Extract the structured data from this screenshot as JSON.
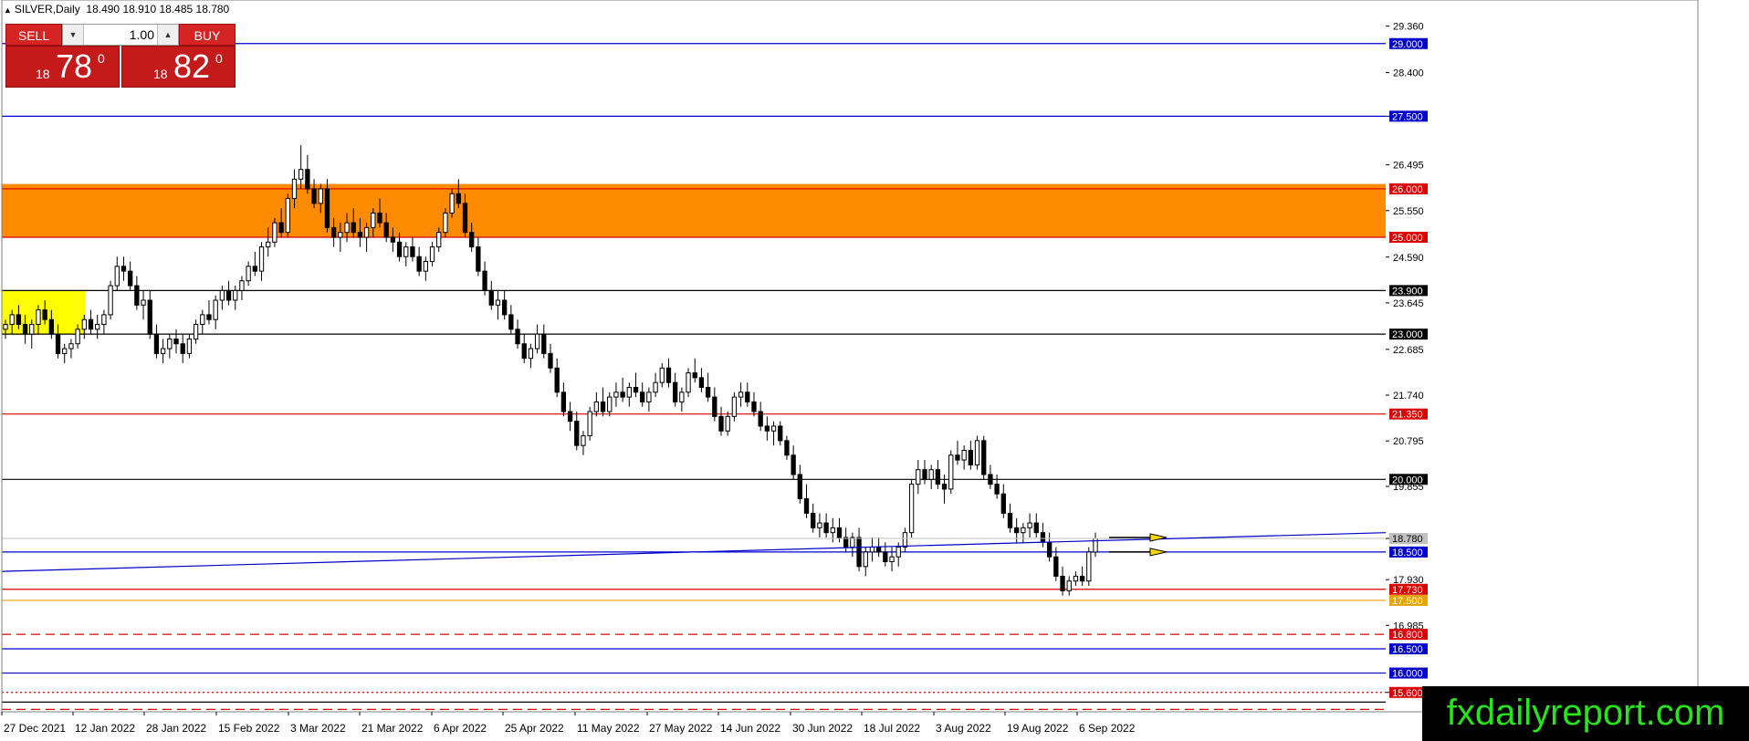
{
  "header": {
    "symbol_icon": "triangle-icon",
    "title": "SILVER,Daily",
    "ohlc": "18.490 18.910 18.485 18.780"
  },
  "trade_panel": {
    "sell_label": "SELL",
    "buy_label": "BUY",
    "quantity": "1.00",
    "sell_price": {
      "prefix": "18",
      "main": "78",
      "sup": "0"
    },
    "buy_price": {
      "prefix": "18",
      "main": "82",
      "sup": "0"
    }
  },
  "watermark": "fxdailyreport.com",
  "colors": {
    "zone_orange": "#ff8c00",
    "zone_yellow": "#ffff00",
    "blue": "#0000cd",
    "red": "#dc0000",
    "black": "#000000",
    "gold": "#e8a400",
    "watermark_green": "#27e51a"
  },
  "chart_data": {
    "type": "candlestick",
    "symbol": "SILVER",
    "timeframe": "Daily",
    "ylim": [
      15.2,
      29.9
    ],
    "y_ticks": [
      "29.360",
      "28.400",
      "27.500",
      "26.495",
      "25.550",
      "24.590",
      "23.645",
      "22.685",
      "21.740",
      "20.795",
      "19.855",
      "18.780",
      "17.930",
      "16.985",
      "15.600"
    ],
    "x_ticks": [
      "27 Dec 2021",
      "12 Jan 2022",
      "28 Jan 2022",
      "15 Feb 2022",
      "3 Mar 2022",
      "21 Mar 2022",
      "6 Apr 2022",
      "25 Apr 2022",
      "11 May 2022",
      "27 May 2022",
      "14 Jun 2022",
      "30 Jun 2022",
      "18 Jul 2022",
      "3 Aug 2022",
      "19 Aug 2022",
      "6 Sep 2022"
    ],
    "current_price": "18.780",
    "zones": [
      {
        "name": "resistance-zone",
        "from": 25.0,
        "to": 26.1,
        "color": "#ff8c00"
      },
      {
        "name": "early-zone",
        "from": 23.0,
        "to": 23.9,
        "color": "#ffff00"
      }
    ],
    "levels": [
      {
        "value": 29.0,
        "label": "29.000",
        "color": "#0000cd",
        "style": "solid"
      },
      {
        "value": 27.5,
        "label": "27.500",
        "color": "#0000cd",
        "style": "solid"
      },
      {
        "value": 26.0,
        "label": "26.000",
        "color": "#dc0000",
        "style": "solid"
      },
      {
        "value": 25.0,
        "label": "25.000",
        "color": "#dc0000",
        "style": "solid"
      },
      {
        "value": 23.9,
        "label": "23.900",
        "color": "#000000",
        "style": "solid"
      },
      {
        "value": 23.0,
        "label": "23.000",
        "color": "#000000",
        "style": "solid"
      },
      {
        "value": 21.35,
        "label": "21.350",
        "color": "#dc0000",
        "style": "solid"
      },
      {
        "value": 20.0,
        "label": "20.000",
        "color": "#000000",
        "style": "solid"
      },
      {
        "value": 18.5,
        "label": "18.500",
        "color": "#0000cd",
        "style": "solid"
      },
      {
        "value": 17.73,
        "label": "17.730",
        "color": "#dc0000",
        "style": "solid"
      },
      {
        "value": 17.5,
        "label": "17.500",
        "color": "#e8a400",
        "style": "solid"
      },
      {
        "value": 16.8,
        "label": "16.800",
        "color": "#dc0000",
        "style": "dashed"
      },
      {
        "value": 16.5,
        "label": "16.500",
        "color": "#0000cd",
        "style": "solid"
      },
      {
        "value": 16.0,
        "label": "16.000",
        "color": "#0000cd",
        "style": "solid"
      },
      {
        "value": 15.6,
        "label": "15.600",
        "color": "#dc0000",
        "style": "dotted"
      }
    ],
    "unlabeled_levels": [
      {
        "value": 15.4,
        "color": "#000000",
        "style": "solid"
      },
      {
        "value": 15.25,
        "color": "#dc0000",
        "style": "dashed"
      }
    ],
    "trendlines": [
      {
        "name": "rising-trendline",
        "from": 18.1,
        "to": 18.9,
        "color": "#0000cd"
      }
    ],
    "arrows": [
      {
        "name": "arrow-upper",
        "value": 18.8
      },
      {
        "name": "arrow-lower",
        "value": 18.5
      }
    ],
    "ohlc": [
      [
        23.1,
        23.3,
        22.9,
        23.2
      ],
      [
        23.2,
        23.5,
        23.0,
        23.4
      ],
      [
        23.4,
        23.6,
        23.1,
        23.2
      ],
      [
        23.2,
        23.4,
        22.8,
        23.0
      ],
      [
        23.0,
        23.3,
        22.7,
        23.2
      ],
      [
        23.2,
        23.6,
        23.0,
        23.5
      ],
      [
        23.5,
        23.7,
        23.2,
        23.3
      ],
      [
        23.3,
        23.5,
        22.9,
        23.0
      ],
      [
        23.0,
        23.2,
        22.5,
        22.6
      ],
      [
        22.6,
        22.8,
        22.4,
        22.7
      ],
      [
        22.7,
        22.9,
        22.5,
        22.8
      ],
      [
        22.8,
        23.2,
        22.7,
        23.1
      ],
      [
        23.1,
        23.4,
        22.9,
        23.3
      ],
      [
        23.3,
        23.5,
        23.0,
        23.1
      ],
      [
        23.1,
        23.4,
        22.9,
        23.2
      ],
      [
        23.2,
        23.5,
        23.0,
        23.4
      ],
      [
        23.4,
        24.1,
        23.3,
        24.0
      ],
      [
        24.0,
        24.6,
        23.9,
        24.4
      ],
      [
        24.4,
        24.6,
        24.1,
        24.3
      ],
      [
        24.3,
        24.5,
        23.9,
        24.0
      ],
      [
        24.0,
        24.2,
        23.5,
        23.6
      ],
      [
        23.6,
        23.9,
        23.3,
        23.7
      ],
      [
        23.7,
        23.9,
        22.9,
        23.0
      ],
      [
        23.0,
        23.2,
        22.5,
        22.6
      ],
      [
        22.6,
        22.9,
        22.4,
        22.7
      ],
      [
        22.7,
        23.0,
        22.5,
        22.9
      ],
      [
        22.9,
        23.1,
        22.6,
        22.8
      ],
      [
        22.8,
        23.0,
        22.4,
        22.6
      ],
      [
        22.6,
        23.0,
        22.5,
        22.9
      ],
      [
        22.9,
        23.3,
        22.8,
        23.2
      ],
      [
        23.2,
        23.5,
        23.0,
        23.4
      ],
      [
        23.4,
        23.7,
        23.2,
        23.3
      ],
      [
        23.3,
        23.8,
        23.1,
        23.7
      ],
      [
        23.7,
        24.0,
        23.5,
        23.9
      ],
      [
        23.9,
        24.1,
        23.6,
        23.7
      ],
      [
        23.7,
        24.0,
        23.5,
        23.9
      ],
      [
        23.9,
        24.2,
        23.7,
        24.1
      ],
      [
        24.1,
        24.5,
        24.0,
        24.4
      ],
      [
        24.4,
        24.7,
        24.2,
        24.3
      ],
      [
        24.3,
        24.9,
        24.1,
        24.8
      ],
      [
        24.8,
        25.2,
        24.6,
        24.9
      ],
      [
        24.9,
        25.4,
        24.8,
        25.3
      ],
      [
        25.3,
        25.6,
        25.0,
        25.1
      ],
      [
        25.1,
        25.9,
        25.0,
        25.8
      ],
      [
        25.8,
        26.4,
        25.6,
        26.2
      ],
      [
        26.2,
        26.9,
        26.0,
        26.4
      ],
      [
        26.4,
        26.7,
        25.9,
        26.0
      ],
      [
        26.0,
        26.2,
        25.6,
        25.7
      ],
      [
        25.7,
        26.1,
        25.5,
        26.0
      ],
      [
        26.0,
        26.2,
        25.1,
        25.2
      ],
      [
        25.2,
        25.4,
        24.8,
        25.0
      ],
      [
        25.0,
        25.3,
        24.7,
        25.1
      ],
      [
        25.1,
        25.5,
        24.9,
        25.3
      ],
      [
        25.3,
        25.6,
        25.0,
        25.1
      ],
      [
        25.1,
        25.4,
        24.8,
        25.0
      ],
      [
        25.0,
        25.3,
        24.7,
        25.2
      ],
      [
        25.2,
        25.6,
        25.0,
        25.5
      ],
      [
        25.5,
        25.8,
        25.2,
        25.3
      ],
      [
        25.3,
        25.5,
        24.9,
        25.0
      ],
      [
        25.0,
        25.2,
        24.7,
        24.9
      ],
      [
        24.9,
        25.1,
        24.5,
        24.6
      ],
      [
        24.6,
        24.9,
        24.4,
        24.8
      ],
      [
        24.8,
        25.0,
        24.5,
        24.6
      ],
      [
        24.6,
        24.8,
        24.2,
        24.3
      ],
      [
        24.3,
        24.6,
        24.1,
        24.5
      ],
      [
        24.5,
        24.9,
        24.4,
        24.8
      ],
      [
        24.8,
        25.2,
        24.7,
        25.1
      ],
      [
        25.1,
        25.6,
        25.0,
        25.5
      ],
      [
        25.5,
        26.0,
        25.4,
        25.9
      ],
      [
        25.9,
        26.2,
        25.6,
        25.7
      ],
      [
        25.7,
        25.9,
        25.0,
        25.1
      ],
      [
        25.1,
        25.3,
        24.7,
        24.8
      ],
      [
        24.8,
        25.0,
        24.2,
        24.3
      ],
      [
        24.3,
        24.5,
        23.8,
        23.9
      ],
      [
        23.9,
        24.1,
        23.5,
        23.6
      ],
      [
        23.6,
        23.9,
        23.3,
        23.7
      ],
      [
        23.7,
        23.9,
        23.3,
        23.4
      ],
      [
        23.4,
        23.6,
        23.0,
        23.1
      ],
      [
        23.1,
        23.3,
        22.7,
        22.8
      ],
      [
        22.8,
        23.0,
        22.4,
        22.5
      ],
      [
        22.5,
        22.8,
        22.3,
        22.7
      ],
      [
        22.7,
        23.2,
        22.6,
        23.0
      ],
      [
        23.0,
        23.2,
        22.5,
        22.6
      ],
      [
        22.6,
        22.8,
        22.2,
        22.3
      ],
      [
        22.3,
        22.5,
        21.7,
        21.8
      ],
      [
        21.8,
        22.0,
        21.3,
        21.4
      ],
      [
        21.4,
        21.6,
        21.0,
        21.2
      ],
      [
        21.2,
        21.4,
        20.6,
        20.7
      ],
      [
        20.7,
        21.0,
        20.5,
        20.9
      ],
      [
        20.9,
        21.5,
        20.8,
        21.4
      ],
      [
        21.4,
        21.8,
        21.3,
        21.6
      ],
      [
        21.6,
        21.9,
        21.3,
        21.4
      ],
      [
        21.4,
        21.8,
        21.3,
        21.7
      ],
      [
        21.7,
        22.0,
        21.5,
        21.8
      ],
      [
        21.8,
        22.1,
        21.6,
        21.7
      ],
      [
        21.7,
        22.0,
        21.5,
        21.9
      ],
      [
        21.9,
        22.2,
        21.7,
        21.8
      ],
      [
        21.8,
        22.0,
        21.5,
        21.6
      ],
      [
        21.6,
        21.9,
        21.4,
        21.8
      ],
      [
        21.8,
        22.2,
        21.7,
        22.0
      ],
      [
        22.0,
        22.4,
        21.9,
        22.3
      ],
      [
        22.3,
        22.5,
        21.9,
        22.0
      ],
      [
        22.0,
        22.2,
        21.5,
        21.6
      ],
      [
        21.6,
        21.9,
        21.4,
        21.8
      ],
      [
        21.8,
        22.3,
        21.7,
        22.2
      ],
      [
        22.2,
        22.5,
        22.0,
        22.1
      ],
      [
        22.1,
        22.3,
        21.8,
        21.9
      ],
      [
        21.9,
        22.2,
        21.6,
        21.7
      ],
      [
        21.7,
        21.9,
        21.2,
        21.3
      ],
      [
        21.3,
        21.5,
        20.9,
        21.0
      ],
      [
        21.0,
        21.4,
        20.9,
        21.3
      ],
      [
        21.3,
        21.8,
        21.2,
        21.7
      ],
      [
        21.7,
        22.0,
        21.5,
        21.8
      ],
      [
        21.8,
        22.0,
        21.5,
        21.6
      ],
      [
        21.6,
        21.8,
        21.3,
        21.4
      ],
      [
        21.4,
        21.6,
        21.0,
        21.1
      ],
      [
        21.1,
        21.3,
        20.8,
        21.0
      ],
      [
        21.0,
        21.2,
        20.7,
        21.1
      ],
      [
        21.1,
        21.2,
        20.7,
        20.8
      ],
      [
        20.8,
        20.9,
        20.4,
        20.5
      ],
      [
        20.5,
        20.7,
        20.0,
        20.1
      ],
      [
        20.1,
        20.3,
        19.5,
        19.6
      ],
      [
        19.6,
        19.9,
        19.2,
        19.3
      ],
      [
        19.3,
        19.5,
        18.9,
        19.0
      ],
      [
        19.0,
        19.3,
        18.8,
        19.1
      ],
      [
        19.1,
        19.3,
        18.8,
        18.9
      ],
      [
        18.9,
        19.2,
        18.7,
        19.0
      ],
      [
        19.0,
        19.2,
        18.7,
        18.8
      ],
      [
        18.8,
        19.0,
        18.5,
        18.6
      ],
      [
        18.6,
        18.9,
        18.4,
        18.8
      ],
      [
        18.8,
        19.0,
        18.1,
        18.2
      ],
      [
        18.2,
        18.6,
        18.0,
        18.5
      ],
      [
        18.5,
        18.8,
        18.3,
        18.6
      ],
      [
        18.6,
        18.8,
        18.4,
        18.5
      ],
      [
        18.5,
        18.7,
        18.2,
        18.3
      ],
      [
        18.3,
        18.6,
        18.1,
        18.4
      ],
      [
        18.4,
        18.7,
        18.2,
        18.6
      ],
      [
        18.6,
        19.0,
        18.5,
        18.9
      ],
      [
        18.9,
        20.0,
        18.8,
        19.9
      ],
      [
        19.9,
        20.4,
        19.7,
        20.2
      ],
      [
        20.2,
        20.4,
        19.9,
        20.0
      ],
      [
        20.0,
        20.3,
        19.8,
        20.2
      ],
      [
        20.2,
        20.4,
        19.8,
        19.9
      ],
      [
        19.9,
        20.1,
        19.5,
        19.8
      ],
      [
        19.8,
        20.6,
        19.7,
        20.5
      ],
      [
        20.5,
        20.8,
        20.3,
        20.4
      ],
      [
        20.4,
        20.7,
        20.2,
        20.6
      ],
      [
        20.6,
        20.8,
        20.2,
        20.3
      ],
      [
        20.3,
        20.9,
        20.2,
        20.8
      ],
      [
        20.8,
        20.9,
        20.0,
        20.1
      ],
      [
        20.1,
        20.3,
        19.8,
        19.9
      ],
      [
        19.9,
        20.1,
        19.6,
        19.7
      ],
      [
        19.7,
        19.9,
        19.2,
        19.3
      ],
      [
        19.3,
        19.5,
        18.9,
        19.0
      ],
      [
        19.0,
        19.2,
        18.7,
        18.9
      ],
      [
        18.9,
        19.1,
        18.7,
        19.0
      ],
      [
        19.0,
        19.3,
        18.8,
        19.1
      ],
      [
        19.1,
        19.3,
        18.8,
        18.9
      ],
      [
        18.9,
        19.1,
        18.6,
        18.7
      ],
      [
        18.7,
        18.9,
        18.3,
        18.4
      ],
      [
        18.4,
        18.6,
        17.9,
        18.0
      ],
      [
        18.0,
        18.2,
        17.6,
        17.7
      ],
      [
        17.7,
        18.0,
        17.6,
        17.9
      ],
      [
        17.9,
        18.1,
        17.8,
        18.0
      ],
      [
        18.0,
        18.2,
        17.8,
        17.9
      ],
      [
        17.9,
        18.6,
        17.8,
        18.5
      ],
      [
        18.5,
        18.9,
        18.4,
        18.78
      ]
    ]
  }
}
